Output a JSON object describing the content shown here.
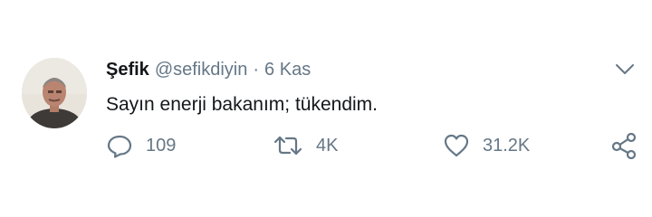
{
  "tweet": {
    "author": {
      "name": "Şefik",
      "handle": "@sefikdiyin",
      "separator": "·",
      "time": "6 Kas"
    },
    "text": "Sayın enerji bakanım; tükendim.",
    "actions": {
      "replies": "109",
      "retweets": "4K",
      "likes": "31.2K"
    },
    "icons": {
      "reply": "reply-icon",
      "retweet": "retweet-icon",
      "like": "heart-icon",
      "share": "share-icon",
      "menu": "chevron-down-icon"
    },
    "colors": {
      "text": "#14171a",
      "secondary": "#657786"
    }
  }
}
